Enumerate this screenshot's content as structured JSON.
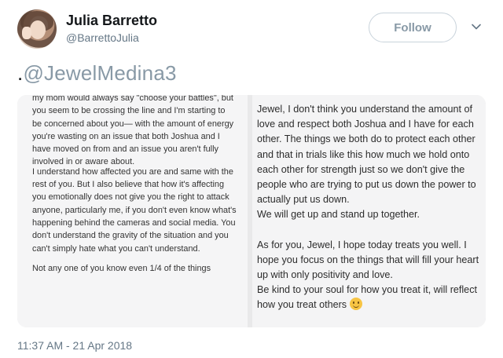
{
  "user": {
    "name": "Julia Barretto",
    "handle": "@BarrettoJulia",
    "follow_label": "Follow"
  },
  "tweet": {
    "prefix": ".",
    "mention": "@JewelMedina3",
    "timestamp": "11:37 AM - 21 Apr 2018"
  },
  "media": {
    "left_paragraphs": [
      "my mom would always say \"choose your battles\", but you seem to be crossing the line and I'm starting to be concerned about you— with the amount of energy you're wasting on an issue that both Joshua and I have moved on from  and an issue you aren't fully involved in or aware about.",
      "I understand how affected you are and same with the rest of you. But I also believe that how it's affecting you emotionally does not give you the right to attack anyone, particularly me, if you don't even know what's happening behind the cameras and social media. You don't understand the gravity of the situation and you can't simply hate what you can't understand.",
      "Not any one of you know even 1/4 of the things"
    ],
    "right_paragraphs": [
      "Jewel, I don't think you understand the amount of love and respect both Joshua and I have for each other. The things we both do to protect each other and that in trials like this how much we hold onto each other for strength just so we don't give the people who are trying to put us down the power to actually put us down.",
      "We will get up and stand up together.",
      "As for you, Jewel, I hope today treats you well. I hope you focus on the things that will fill your heart up with only positivity and love.",
      "Be kind to your soul for how you treat it, will reflect how you treat others"
    ]
  },
  "icons": {
    "more": "chevron-down-icon",
    "emoji": "smiling-face-emoji-icon"
  },
  "colors": {
    "secondary_text": "#657786",
    "mention": "#8899a6",
    "follow_border": "#c9d3db"
  }
}
